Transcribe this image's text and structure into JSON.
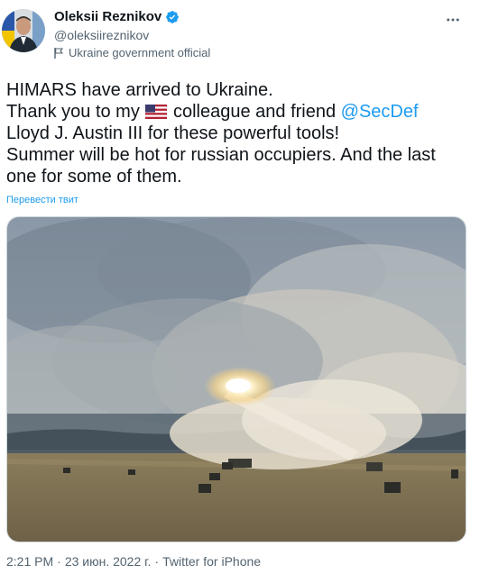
{
  "author": {
    "name": "Oleksii Reznikov",
    "handle": "@oleksiireznikov",
    "label": "Ukraine government official"
  },
  "tweet": {
    "line1": "HIMARS have arrived to Ukraine.",
    "line2_pre": "Thank you to my",
    "line2_post": " colleague and friend ",
    "mention": "@SecDef",
    "line3": "Lloyd J. Austin III for these powerful tools!",
    "line4": "Summer will be hot for russian occupiers. And the last",
    "line5": "one for some of them.",
    "flag_emoji": "us-flag-icon"
  },
  "translate_label": "Перевести твит",
  "meta": {
    "time": "2:21 PM",
    "dot1": "·",
    "date": "23 июн. 2022 г.",
    "dot2": "·",
    "source": "Twitter for iPhone"
  },
  "colors": {
    "accent": "#1d9bf0",
    "secondary_text": "#536471",
    "verified": "#1d9bf0"
  }
}
